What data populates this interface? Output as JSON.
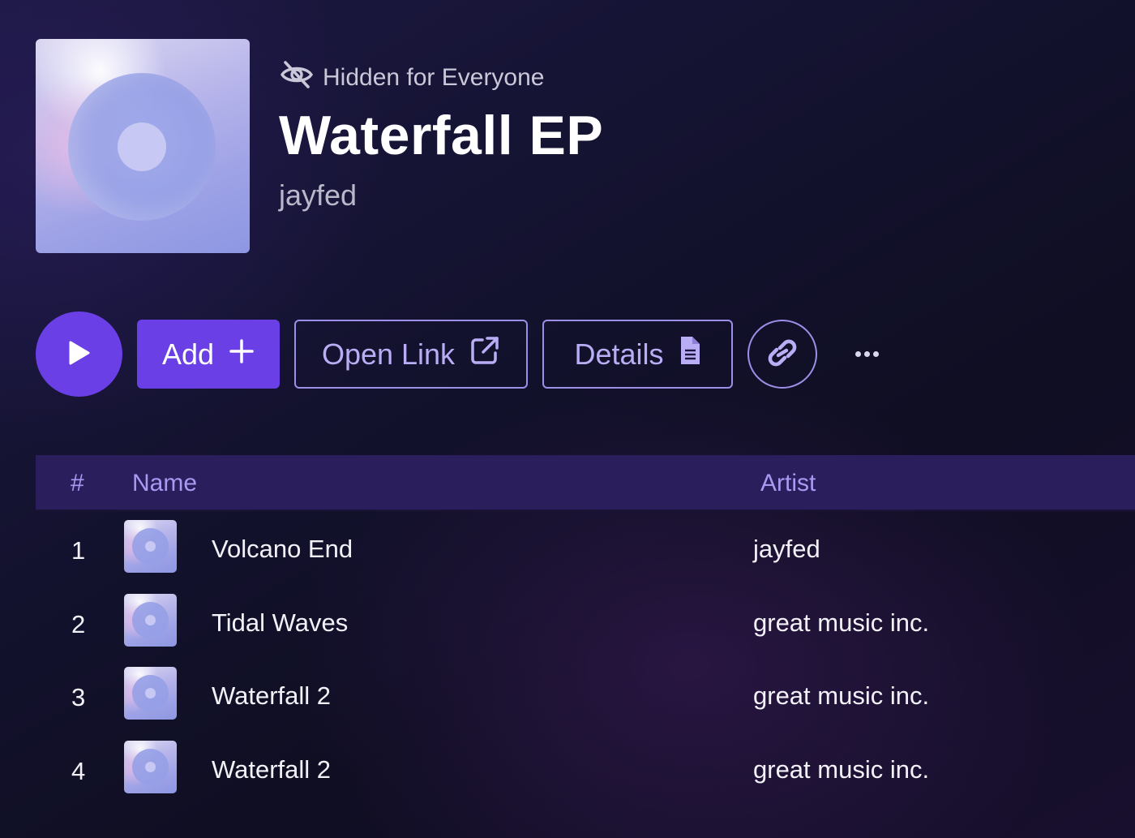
{
  "album": {
    "visibility_label": "Hidden for Everyone",
    "visibility_icon": "eye-slash-icon",
    "title": "Waterfall EP",
    "artist": "jayfed",
    "cover_icon": "album-art"
  },
  "actions": {
    "play_icon": "play-icon",
    "add_label": "Add",
    "add_icon": "plus-icon",
    "open_link_label": "Open Link",
    "open_link_icon": "external-link-icon",
    "details_label": "Details",
    "details_icon": "document-icon",
    "copy_link_icon": "link-icon",
    "more_icon": "more-horizontal-icon"
  },
  "table": {
    "headers": {
      "num": "#",
      "name": "Name",
      "artist": "Artist"
    },
    "rows": [
      {
        "num": "1",
        "name": "Volcano End",
        "artist": "jayfed"
      },
      {
        "num": "2",
        "name": "Tidal Waves",
        "artist": "great music inc."
      },
      {
        "num": "3",
        "name": "Waterfall 2",
        "artist": "great music inc."
      },
      {
        "num": "4",
        "name": "Waterfall 2",
        "artist": "great music inc."
      }
    ]
  },
  "colors": {
    "accent": "#6a3fe6",
    "outline": "#9d8fe8",
    "header_bg": "#2a1f5c",
    "header_text": "#a999f2",
    "background": "#13122e"
  }
}
